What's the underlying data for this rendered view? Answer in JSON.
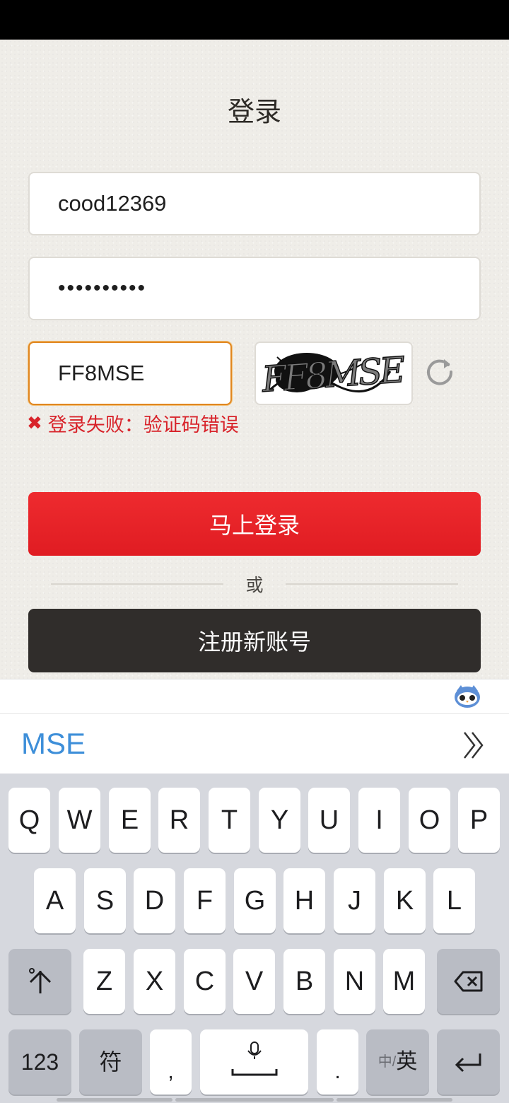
{
  "login": {
    "title": "登录",
    "username_value": "cood12369",
    "password_value": "••••••••••",
    "captcha_value": "FF8MSE",
    "captcha_image_text": "FF8MSE",
    "error_message": "登录失败：验证码错误",
    "login_button": "马上登录",
    "divider_text": "或",
    "register_button": "注册新账号"
  },
  "ime": {
    "candidate": "MSE"
  },
  "keyboard": {
    "row1": [
      "Q",
      "W",
      "E",
      "R",
      "T",
      "Y",
      "U",
      "I",
      "O",
      "P"
    ],
    "row2": [
      "A",
      "S",
      "D",
      "F",
      "G",
      "H",
      "J",
      "K",
      "L"
    ],
    "row3": [
      "Z",
      "X",
      "C",
      "V",
      "B",
      "N",
      "M"
    ],
    "num_key": "123",
    "symbol_key": "符",
    "comma_key": ",",
    "period_key": ".",
    "lang_small": "中/",
    "lang_main": "英"
  },
  "colors": {
    "accent_red": "#e4222a",
    "dark_button": "#302d2b",
    "error": "#d8232a",
    "focus_border": "#e0861f",
    "candidate_blue": "#3e8fd9"
  },
  "icons": [
    "refresh-icon",
    "error-icon",
    "mascot-icon",
    "expand-icon",
    "shift-icon",
    "backspace-icon",
    "microphone-icon",
    "space-icon",
    "enter-icon"
  ]
}
